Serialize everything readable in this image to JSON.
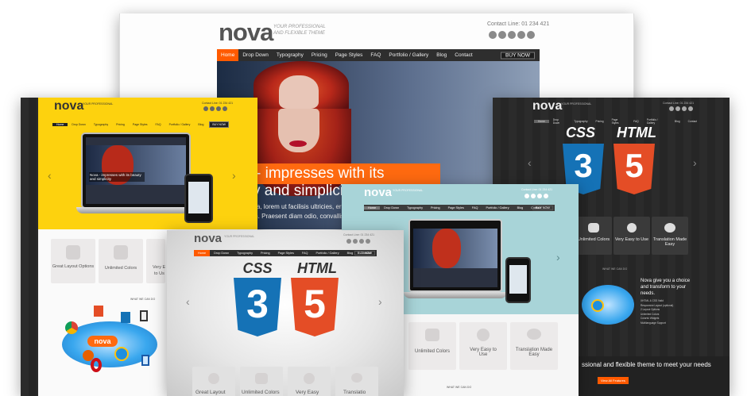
{
  "brand": {
    "logo": "nova",
    "tagline_1": "YOUR PROFESSIONAL",
    "tagline_2": "AND FLEXIBLE THEME"
  },
  "contact": "Contact Line: 01 234 421",
  "contact_small": "Contact Line: 01 234 421",
  "nav": [
    "Home",
    "Drop Down",
    "Typography",
    "Pricing",
    "Page Styles",
    "FAQ",
    "Portfolio / Gallery",
    "Blog",
    "Contact"
  ],
  "buy_now": "BUY NOW",
  "hero": {
    "line1": "- impresses with its",
    "line2": "y and simplicit",
    "line3": "tra, lorem ut facilisis ultricies, eros",
    "line4": "m. Praesent diam odio, convallis a"
  },
  "yellow_caption": "Nova - impresses with its beauty and simplicity",
  "badges": {
    "css": "CSS",
    "html": "HTML",
    "css_num": "3",
    "html_num": "5"
  },
  "features": {
    "great_layout": "Great Layout Options",
    "unlimited": "Unlimited Colors",
    "easy": "Very Easy to Use",
    "translation": "Translation Made Easy",
    "very_short": "Very E",
    "very_short2": "to Us",
    "great_layout_short": "Great Layout",
    "unlimited_short": "Unlimited Colors",
    "very_easy_short": "Very Easy",
    "translation_short": "Translatio"
  },
  "what_we_do": "WHAT WE CAN DO",
  "dark_right": {
    "promo_1": "Nova give you a choice",
    "promo_2": "and transform to your",
    "promo_3": "needs.",
    "bullets": [
      "XHTML & CSS Valid",
      "Responsive Layout (optional)",
      "2 Layout Options",
      "Unlimited Colors",
      "Colorful Widgets",
      "Multilanguage Support"
    ],
    "banner": "ssional and flexible theme to meet your needs",
    "cta": "View All Features"
  },
  "colors": {
    "orange": "#ff5a00",
    "yellow": "#fdd20e",
    "teal": "#a8d4d8",
    "dark": "#2a2a2a"
  },
  "icons": [
    "facebook-icon",
    "twitter-icon",
    "skype-icon",
    "rss-icon",
    "camera-icon",
    "chevron-left-icon",
    "chevron-right-icon"
  ]
}
